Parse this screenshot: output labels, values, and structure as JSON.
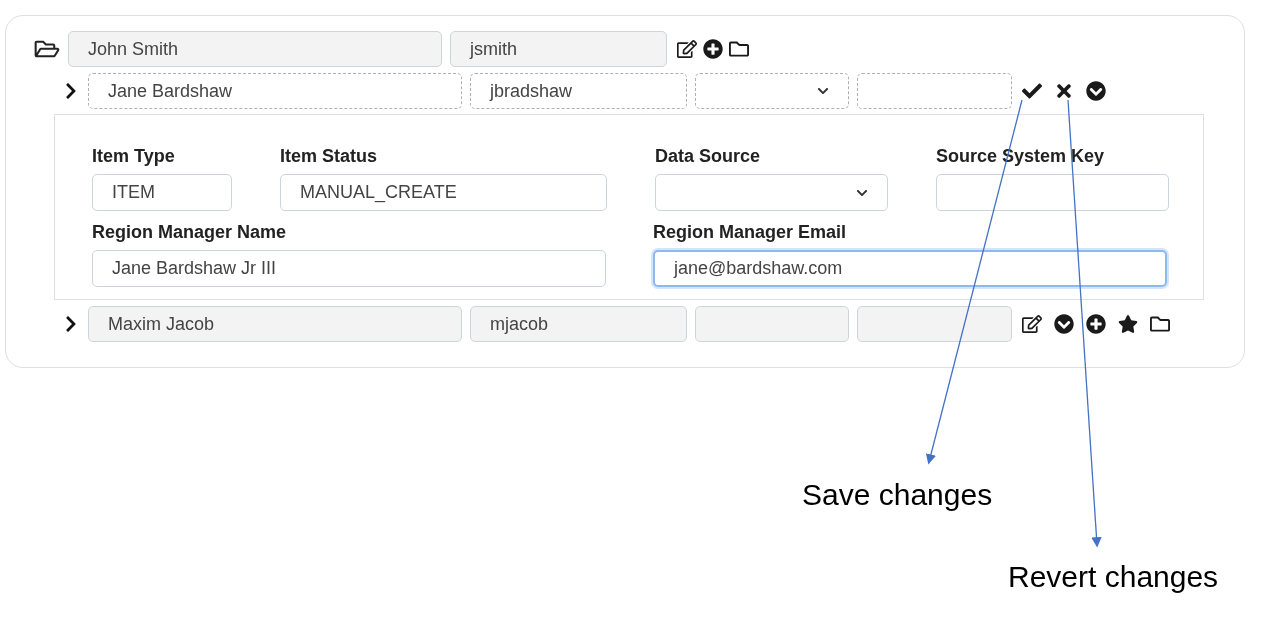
{
  "tree": {
    "root": {
      "expanded": true,
      "name": "John Smith",
      "username": "jsmith",
      "actions": [
        {
          "kind": "edit"
        },
        {
          "kind": "add"
        },
        {
          "kind": "folder"
        }
      ]
    },
    "children": [
      {
        "editing": true,
        "name": "Jane Bardshaw",
        "username": "jbradshaw",
        "actions": [
          {
            "kind": "save"
          },
          {
            "kind": "revert"
          },
          {
            "kind": "expand"
          }
        ],
        "details": [
          [
            {
              "label": "Item Type",
              "value": "ITEM",
              "kind": "text",
              "focused": false
            },
            {
              "label": "Item Status",
              "value": "MANUAL_CREATE",
              "kind": "text",
              "focused": false
            },
            {
              "label": "Data Source",
              "kind": "select",
              "focused": false
            },
            {
              "label": "Source System Key",
              "kind": "text",
              "focused": false
            }
          ],
          [
            {
              "label": "Region Manager Name",
              "value": "Jane Bardshaw Jr III",
              "kind": "text",
              "focused": false
            },
            {
              "label": "Region Manager Email",
              "value": "jane@bardshaw.com",
              "kind": "text",
              "focused": true
            }
          ]
        ]
      },
      {
        "editing": false,
        "name": "Maxim Jacob",
        "username": "mjacob",
        "actions": [
          {
            "kind": "edit"
          },
          {
            "kind": "expand"
          },
          {
            "kind": "add"
          },
          {
            "kind": "star"
          },
          {
            "kind": "folder"
          }
        ]
      }
    ]
  },
  "annotations": [
    {
      "text": "Save changes"
    },
    {
      "text": "Revert changes"
    }
  ]
}
